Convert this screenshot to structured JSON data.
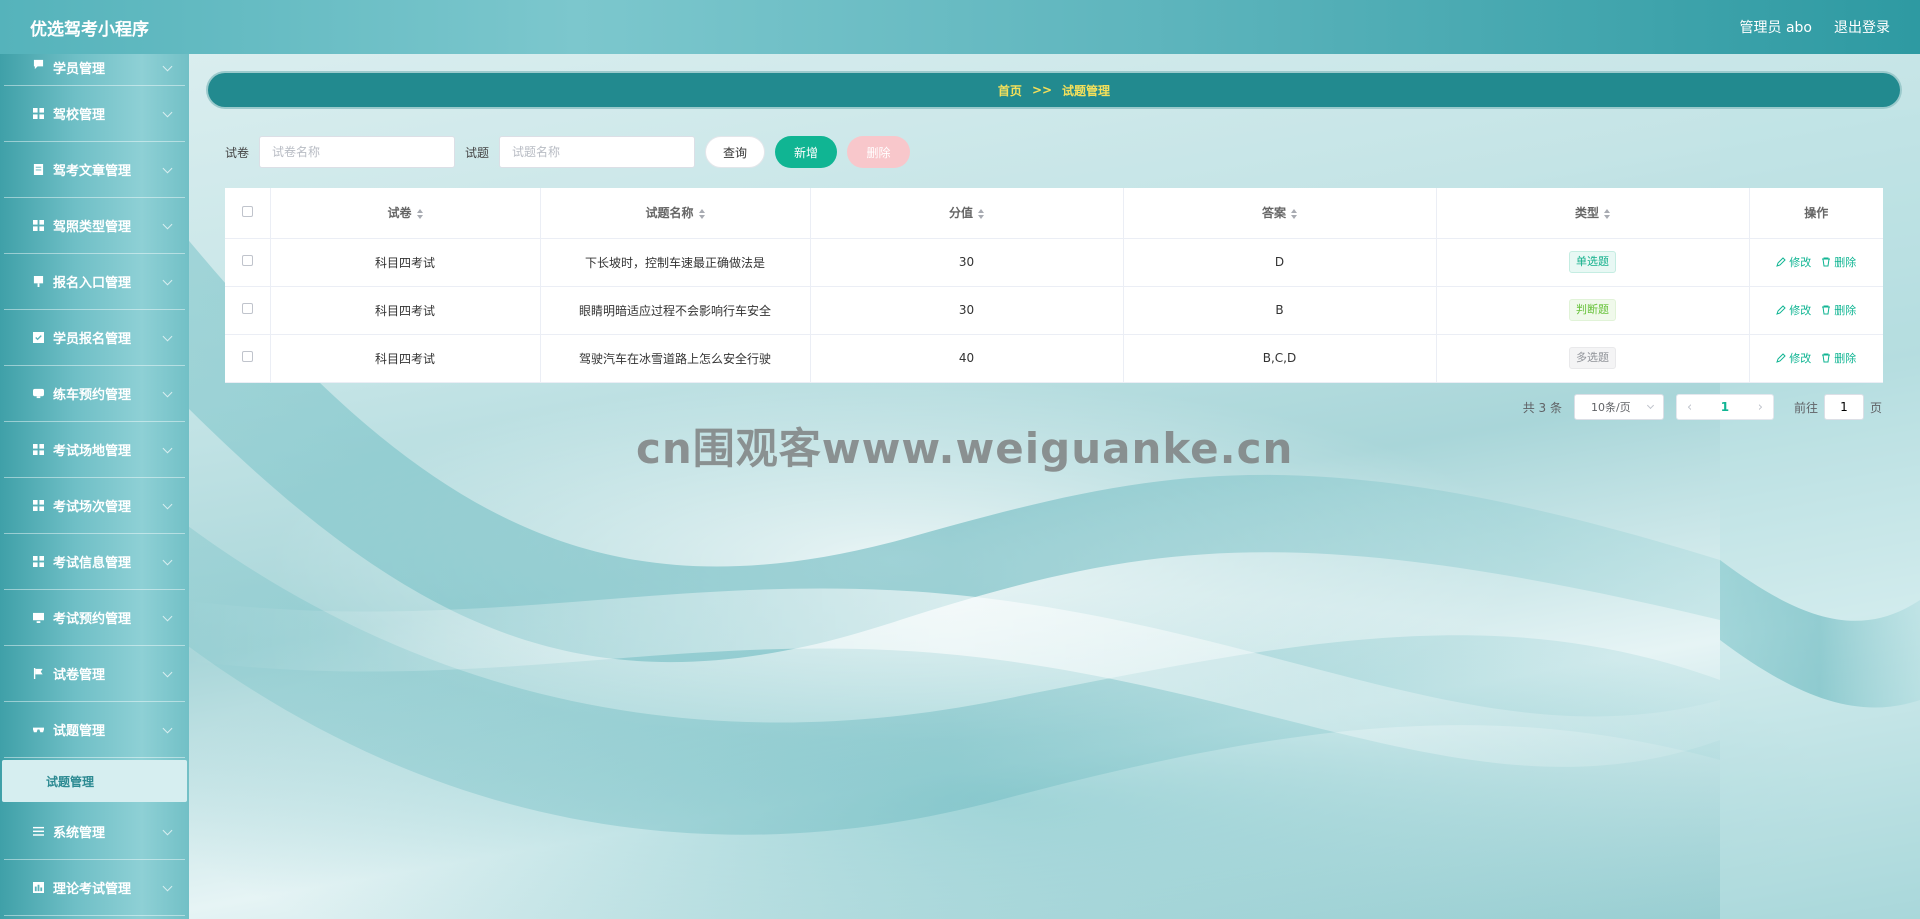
{
  "header": {
    "app_title": "优选驾考小程序",
    "user_label": "管理员 abo",
    "logout_label": "退出登录"
  },
  "sidebar": {
    "items": [
      {
        "label": "学员管理",
        "icon": "chat-icon"
      },
      {
        "label": "驾校管理",
        "icon": "grid-icon"
      },
      {
        "label": "驾考文章管理",
        "icon": "doc-icon"
      },
      {
        "label": "驾照类型管理",
        "icon": "grid-icon"
      },
      {
        "label": "报名入口管理",
        "icon": "entry-icon"
      },
      {
        "label": "学员报名管理",
        "icon": "check-doc-icon"
      },
      {
        "label": "练车预约管理",
        "icon": "chat-icon"
      },
      {
        "label": "考试场地管理",
        "icon": "grid-icon"
      },
      {
        "label": "考试场次管理",
        "icon": "grid-icon"
      },
      {
        "label": "考试信息管理",
        "icon": "grid-icon"
      },
      {
        "label": "考试预约管理",
        "icon": "monitor-icon"
      },
      {
        "label": "试卷管理",
        "icon": "flag-icon"
      },
      {
        "label": "试题管理",
        "icon": "glasses-icon"
      },
      {
        "label": "系统管理",
        "icon": "list-icon"
      },
      {
        "label": "理论考试管理",
        "icon": "chart-icon"
      }
    ],
    "sub_item": "试题管理"
  },
  "breadcrumb": {
    "home": "首页",
    "separator": ">>",
    "current": "试题管理"
  },
  "search": {
    "paper_label": "试卷",
    "paper_placeholder": "试卷名称",
    "question_label": "试题",
    "question_placeholder": "试题名称",
    "query_label": "查询",
    "add_label": "新增",
    "delete_label": "删除"
  },
  "table": {
    "headers": [
      "试卷",
      "试题名称",
      "分值",
      "答案",
      "类型",
      "操作"
    ],
    "rows": [
      {
        "paper": "科目四考试",
        "question": "下长坡时，控制车速最正确做法是",
        "score": "30",
        "answer": "D",
        "type": "单选题",
        "type_style": "single"
      },
      {
        "paper": "科目四考试",
        "question": "眼睛明暗适应过程不会影响行车安全",
        "score": "30",
        "answer": "B",
        "type": "判断题",
        "type_style": "judge"
      },
      {
        "paper": "科目四考试",
        "question": "驾驶汽车在冰雪道路上怎么安全行驶",
        "score": "40",
        "answer": "B,C,D",
        "type": "多选题",
        "type_style": "multi"
      }
    ],
    "edit_label": "修改",
    "delete_label": "删除"
  },
  "pagination": {
    "total": "共 3 条",
    "page_size": "10条/页",
    "current_page": "1",
    "jump_prefix": "前往",
    "jump_value": "1",
    "jump_suffix": "页"
  },
  "watermark": "cn围观客www.weiguanke.cn",
  "colors": {
    "accent": "#10b593",
    "breadcrumb_bg": "#228a8f",
    "breadcrumb_text": "#f5e05a",
    "header_start": "#55b3bb",
    "header_end": "#2e9aa2"
  }
}
